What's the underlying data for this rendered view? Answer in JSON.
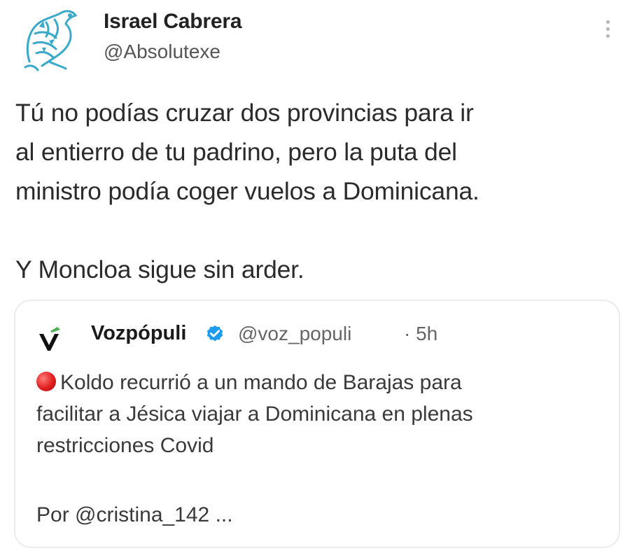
{
  "tweet": {
    "author_name": "Israel Cabrera",
    "author_handle": "@Absolutexe",
    "avatar_icon": "dragon-emblem-avatar",
    "more_icon": "vertical-ellipsis-icon",
    "body_lines": [
      "Tú no podías cruzar dos provincias para ir",
      "al entierro de tu padrino, pero la  puta del",
      "ministro podía coger vuelos a Dominicana."
    ],
    "body_closing": "Y Moncloa sigue sin arder."
  },
  "quoted_tweet": {
    "logo_icon": "vozpopuli-v-logo-icon",
    "author_name": "Vozpópuli",
    "verified_icon": "verified-badge-icon",
    "author_handle": "@voz_populi",
    "time": "· 5h",
    "text_lines": [
      "Koldo recurrió a un mando de Barajas para",
      "facilitar a Jésica viajar a Dominicana en plenas",
      "restricciones Covid"
    ],
    "byline": "Por @cristina_142 ..."
  },
  "colors": {
    "verified_blue": "#1d9bf0",
    "avatar_teal": "#3aa9c9",
    "red_dot": "#e01e1e",
    "logo_green": "#4caf50"
  }
}
